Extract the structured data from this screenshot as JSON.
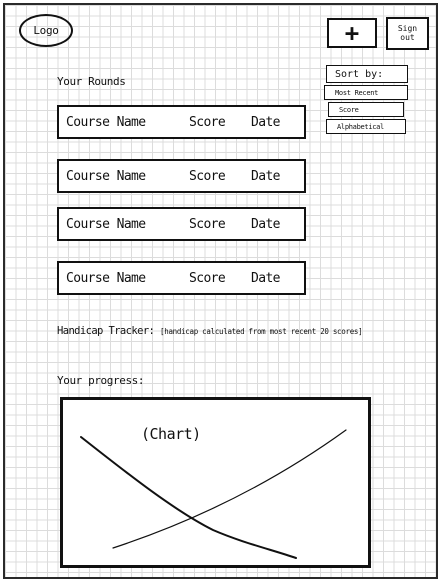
{
  "header": {
    "logo_text": "Logo",
    "add_label": "+",
    "signout_label": "Sign out"
  },
  "rounds": {
    "title": "Your Rounds",
    "items": [
      {
        "name": "Course Name",
        "score": "Score",
        "date": "Date"
      },
      {
        "name": "Course Name",
        "score": "Score",
        "date": "Date"
      },
      {
        "name": "Course Name",
        "score": "Score",
        "date": "Date"
      },
      {
        "name": "Course Name",
        "score": "Score",
        "date": "Date"
      }
    ]
  },
  "sort": {
    "title": "Sort by:",
    "options": [
      "Most Recent",
      "Score",
      "Alphabetical"
    ]
  },
  "handicap": {
    "label": "Handicap Tracker:",
    "note": "[handicap calculated from most recent 20 scores]"
  },
  "progress": {
    "label": "Your progress:",
    "chart_placeholder": "(Chart)"
  }
}
